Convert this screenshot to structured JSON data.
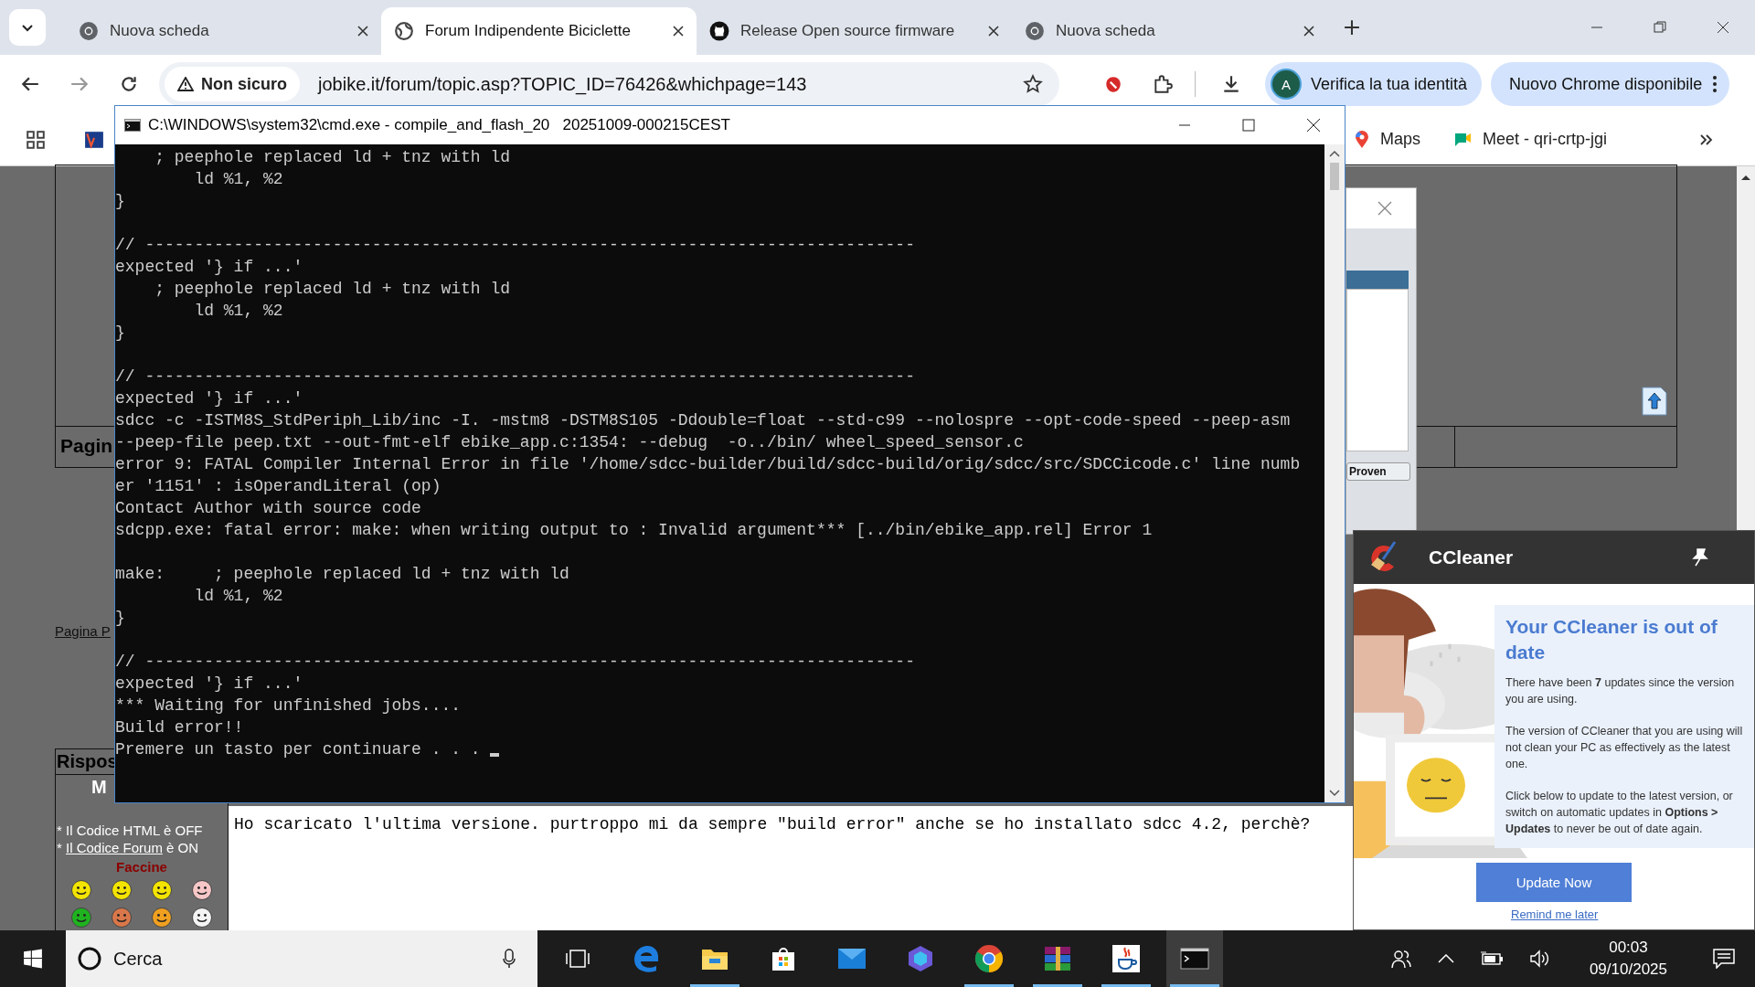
{
  "browser": {
    "tabs": [
      {
        "title": "Nuova scheda",
        "kind": "chrome",
        "selected": false
      },
      {
        "title": "Forum Indipendente Biciclette",
        "kind": "globe",
        "selected": true
      },
      {
        "title": "Release Open source firmware",
        "kind": "github",
        "selected": false
      },
      {
        "title": "Nuova scheda",
        "kind": "chrome",
        "selected": false
      }
    ],
    "security_chip": "Non sicuro",
    "url": "jobike.it/forum/topic.asp?TOPIC_ID=76426&whichpage=143",
    "profile_initial": "A",
    "profile_button": "Verifica la tua identità",
    "update_button": "Nuovo Chrome disponibile",
    "bookmarks": [
      {
        "label": "Maps",
        "kind": "maps"
      },
      {
        "label": "Meet - qri-crtp-jgi",
        "kind": "meet"
      }
    ]
  },
  "forum": {
    "page_heading": "Pagin",
    "page_link": "Pagina P",
    "reply_heading": "Rispos",
    "reply_subheading": "M",
    "notes": [
      {
        "bullet": "*",
        "name": "Il Codice HTML",
        "value": "è OFF",
        "link": false
      },
      {
        "bullet": "*",
        "name": "Il Codice Forum",
        "value": "è ON",
        "link": true
      }
    ],
    "smileys_title": "Faccine",
    "smileys": [
      {
        "color": "#f3e300"
      },
      {
        "color": "#f3e300"
      },
      {
        "color": "#f3e300"
      },
      {
        "color": "#f7c6c6"
      },
      {
        "color": "#1fb31f"
      },
      {
        "color": "#d9774a"
      },
      {
        "color": "#f0a020"
      },
      {
        "color": "#f4f4f4"
      }
    ],
    "reply_text": "Ho scaricato l'ultima versione. purtroppo mi da sempre \"build error\" anche se ho installato sdcc 4.2, perchè?"
  },
  "dialog": {
    "button": "Proven"
  },
  "console": {
    "title": "C:\\WINDOWS\\system32\\cmd.exe - compile_and_flash_20   20251009-000215CEST",
    "cursor": true,
    "blocks": [
      [
        "    ; peephole replaced ld + tnz with ld",
        "        ld %1, %2",
        "}"
      ],
      [
        "// ------------------------------------------------------------------------------",
        "expected '} if ...'",
        "    ; peephole replaced ld + tnz with ld",
        "        ld %1, %2",
        "}"
      ],
      [
        "// ------------------------------------------------------------------------------",
        "expected '} if ...'",
        "sdcc -c -ISTM8S_StdPeriph_Lib/inc -I. -mstm8 -DSTM8S105 -Ddouble=float --std-c99 --nolospre --opt-code-speed --peep-asm",
        "--peep-file peep.txt --out-fmt-elf ebike_app.c:1354: --debug  -o../bin/ wheel_speed_sensor.c",
        "error 9: FATAL Compiler Internal Error in file '/home/sdcc-builder/build/sdcc-build/orig/sdcc/src/SDCCicode.c' line numb",
        "er '1151' : isOperandLiteral (op)",
        "Contact Author with source code",
        "sdcpp.exe: fatal error: make: when writing output to : Invalid argument*** [../bin/ebike_app.rel] Error 1"
      ],
      [
        "make:     ; peephole replaced ld + tnz with ld",
        "        ld %1, %2",
        "}"
      ],
      [
        "// ------------------------------------------------------------------------------",
        "expected '} if ...'",
        "*** Waiting for unfinished jobs....",
        "Build error!!",
        "Premere un tasto per continuare . . . "
      ]
    ]
  },
  "ccleaner": {
    "app_name": "CCleaner",
    "heading": "Your CCleaner is out of date",
    "paragraphs": [
      "There have been **7** updates since the version you are using.",
      "The version of CCleaner that you are using will not clean your PC as effectively as the latest one.",
      "Click below to update to the latest version, or switch on automatic updates in **Options > Updates** to never be out of date again."
    ],
    "button": "Update Now",
    "link": "Remind me later"
  },
  "taskbar": {
    "placeholder": "Cerca",
    "apps": [
      {
        "kind": "taskview",
        "running": false,
        "active": false
      },
      {
        "kind": "edge",
        "running": false,
        "active": false
      },
      {
        "kind": "folder",
        "running": true,
        "active": false
      },
      {
        "kind": "store",
        "running": false,
        "active": false
      },
      {
        "kind": "mail",
        "running": false,
        "active": false
      },
      {
        "kind": "copilot",
        "running": false,
        "active": false
      },
      {
        "kind": "chrome",
        "running": true,
        "active": false
      },
      {
        "kind": "archive",
        "running": true,
        "active": false
      },
      {
        "kind": "java",
        "running": true,
        "active": false
      },
      {
        "kind": "terminal",
        "running": true,
        "active": true
      }
    ],
    "time": "00:03",
    "date": "09/10/2025"
  }
}
